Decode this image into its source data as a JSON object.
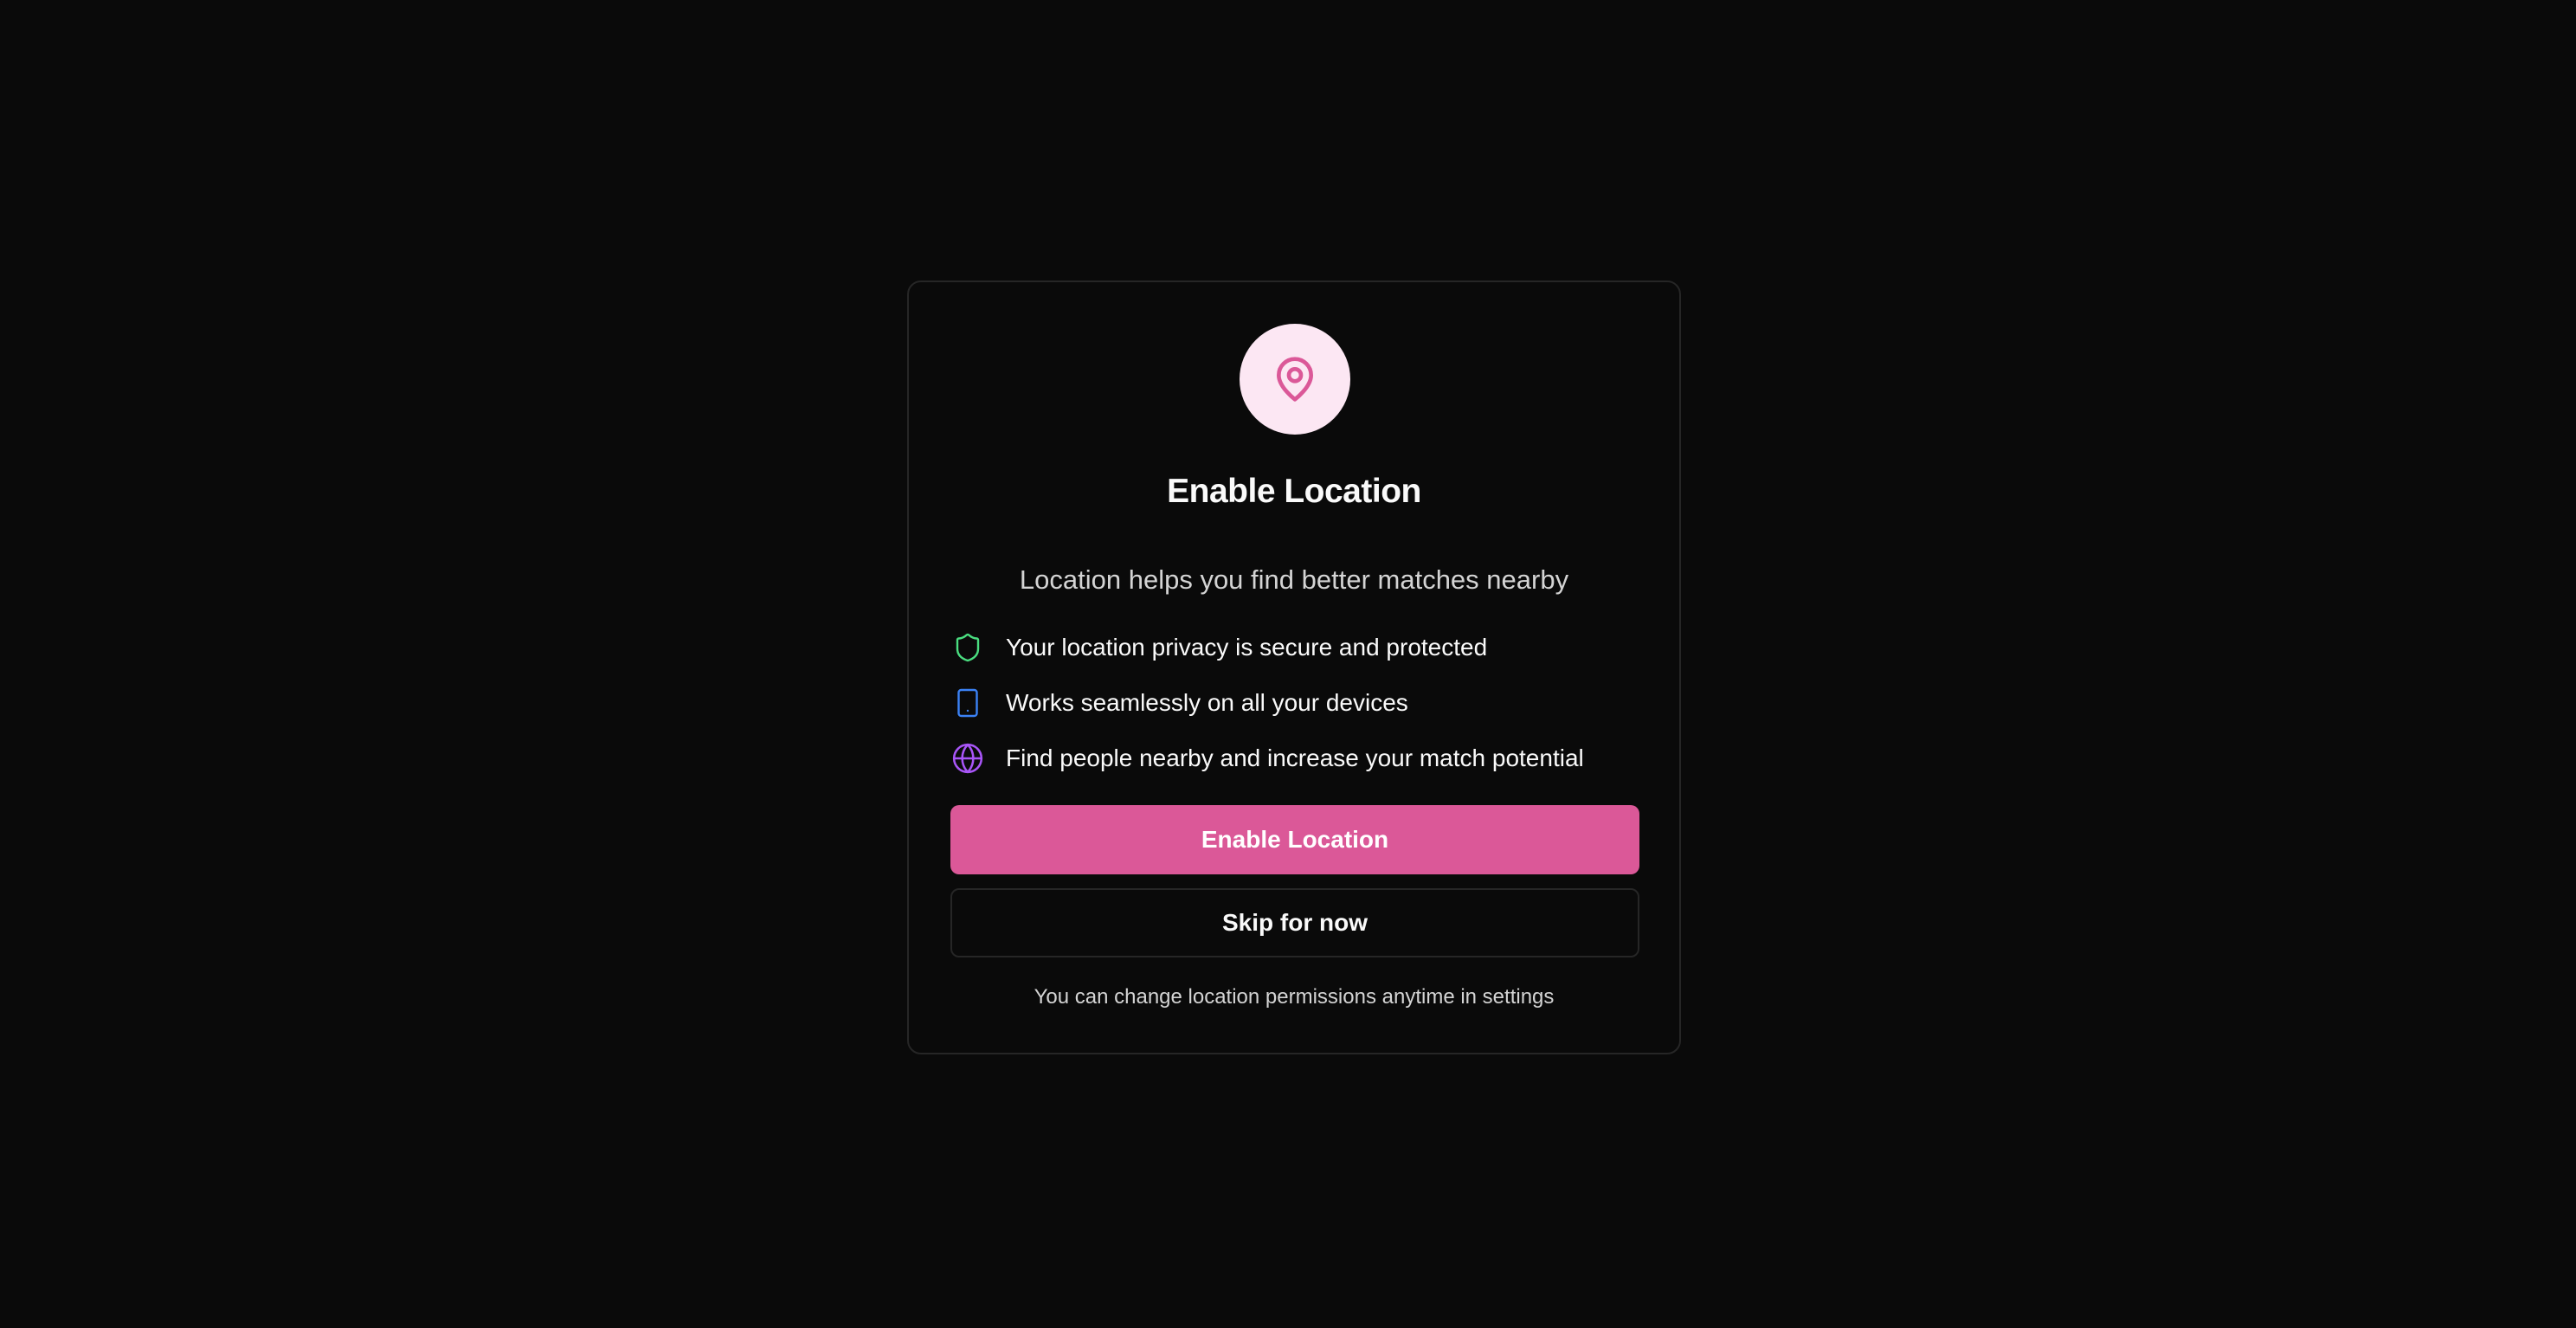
{
  "dialog": {
    "icon": "map-pin-icon",
    "title": "Enable Location",
    "subtitle": "Location helps you find better matches nearby",
    "features": [
      {
        "icon": "shield-icon",
        "color": "#4ade80",
        "text": "Your location privacy is secure and protected"
      },
      {
        "icon": "smartphone-icon",
        "color": "#3b82f6",
        "text": "Works seamlessly on all your devices"
      },
      {
        "icon": "globe-icon",
        "color": "#a855f7",
        "text": "Find people nearby and increase your match potential"
      }
    ],
    "primary_button": "Enable Location",
    "secondary_button": "Skip for now",
    "footnote": "You can change location permissions anytime in settings"
  },
  "colors": {
    "background": "#0a0a0a",
    "accent": "#db5898",
    "icon_circle_bg": "#fce7f3",
    "border": "#262626"
  }
}
